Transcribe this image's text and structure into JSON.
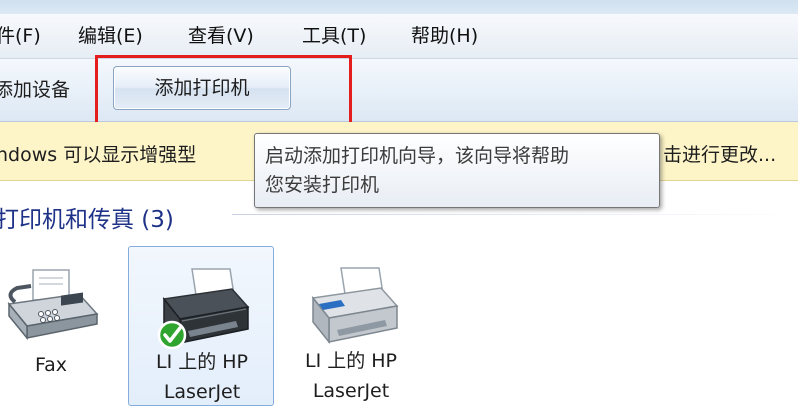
{
  "menubar": {
    "items": [
      "件(F)",
      "编辑(E)",
      "查看(V)",
      "工具(T)",
      "帮助(H)"
    ]
  },
  "toolbar": {
    "add_device": "添加设备",
    "add_printer": "添加打印机"
  },
  "infobar": {
    "text_left": "ndows 可以显示增强型",
    "text_right": "击进行更改..."
  },
  "tooltip": {
    "line1": "启动添加打印机向导，该向导将帮助",
    "line2": "您安装打印机"
  },
  "group": {
    "title": "打印机和传真 (3)"
  },
  "devices": [
    {
      "name": "Fax",
      "name2": "",
      "icon": "fax-icon",
      "selected": false
    },
    {
      "name": "LI 上的 HP",
      "name2": "LaserJet",
      "icon": "printer-icon",
      "selected": true,
      "default": true
    },
    {
      "name": "LI 上的 HP",
      "name2": "LaserJet",
      "icon": "printer-icon",
      "selected": false
    }
  ],
  "colors": {
    "highlight": "#e41d1d",
    "group_title": "#1e3287",
    "infobar_bg": "#fdf5c8",
    "default_check": "#2fa52f"
  }
}
